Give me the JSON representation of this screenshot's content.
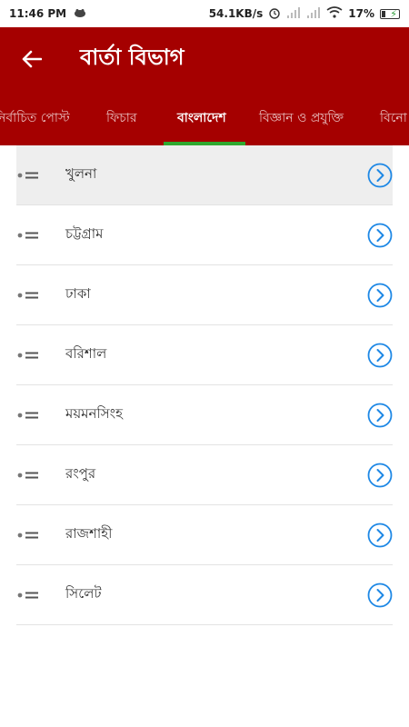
{
  "status": {
    "time": "11:46 PM",
    "net_speed": "54.1KB/s",
    "battery": "17%"
  },
  "header": {
    "title": "বার্তা বিভাগ"
  },
  "tabs": [
    {
      "label": "নির্বাচিত পোস্ট"
    },
    {
      "label": "ফিচার"
    },
    {
      "label": "বাংলাদেশ"
    },
    {
      "label": "বিজ্ঞান ও প্রযুক্তি"
    },
    {
      "label": "বিনো"
    }
  ],
  "active_tab": "বাংলাদেশ",
  "divisions": [
    {
      "label": "খুলনা"
    },
    {
      "label": "চট্টগ্রাম"
    },
    {
      "label": "ঢাকা"
    },
    {
      "label": "বরিশাল"
    },
    {
      "label": "ময়মনসিংহ"
    },
    {
      "label": "রংপুর"
    },
    {
      "label": "রাজশাহী"
    },
    {
      "label": "সিলেট"
    }
  ],
  "colors": {
    "app_bar": "#a50000",
    "tab_indicator": "#2fa82f",
    "chevron": "#1e88e5"
  },
  "icons": {
    "back": "arrow-left-icon",
    "row_left": "list-icon",
    "row_right": "chevron-right-circle-icon"
  }
}
